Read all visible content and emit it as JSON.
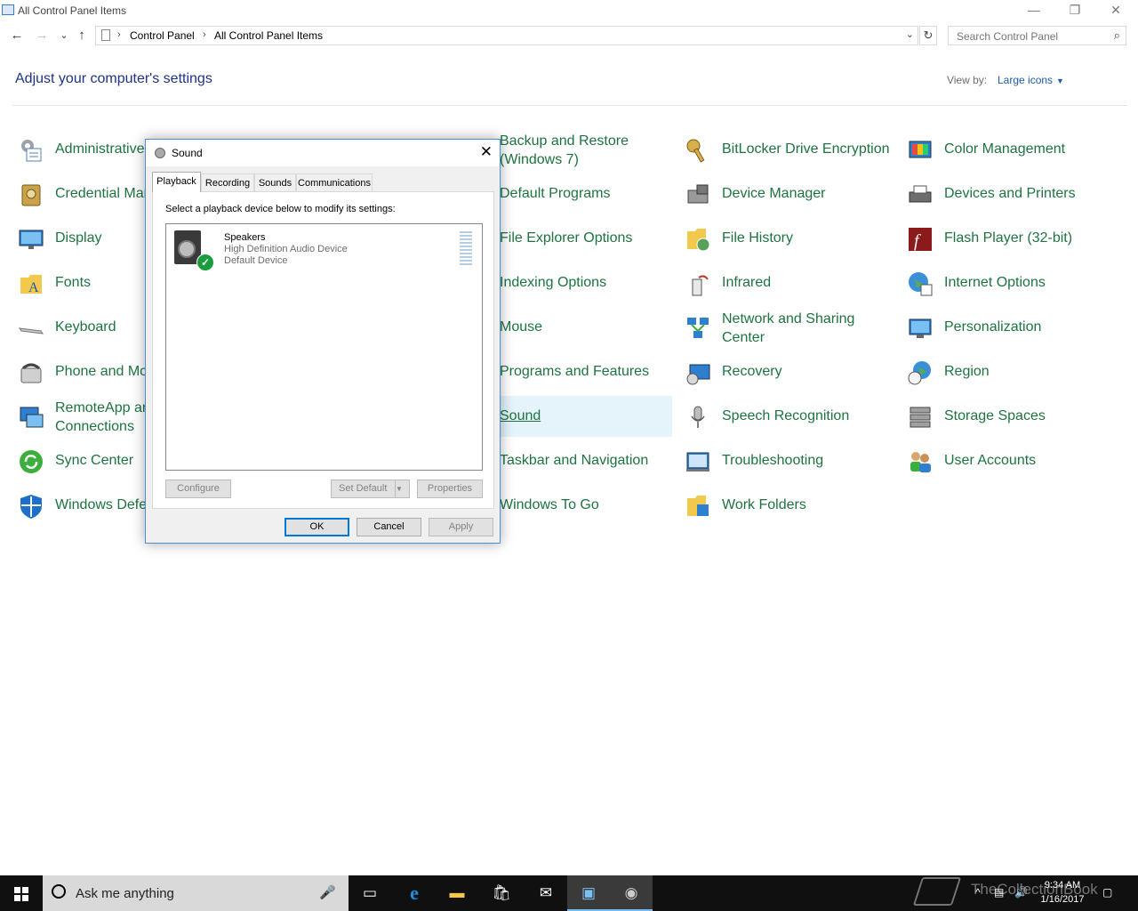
{
  "window": {
    "title": "All Control Panel Items",
    "minimize": "—",
    "restore": "❐",
    "close": "✕"
  },
  "nav": {
    "back": "←",
    "forward": "→",
    "recent": "⌄",
    "up": "↑",
    "breadcrumb": [
      "Control Panel",
      "All Control Panel Items"
    ],
    "refresh": "↻",
    "search_placeholder": "Search Control Panel"
  },
  "header": {
    "title": "Adjust your computer's settings",
    "view_by_label": "View by:",
    "view_by_value": "Large icons"
  },
  "items": {
    "col1": [
      "Administrative Tools",
      "Credential Manager",
      "Display",
      "Fonts",
      "Keyboard",
      "Phone and Modem",
      "RemoteApp and Desktop Connections",
      "Sync Center",
      "Windows Defender Firewall"
    ],
    "col1_visible": [
      "Administrative",
      "Credential Man",
      "Display",
      "Fonts",
      "Keyboard",
      "Phone and Mo",
      "RemoteApp an Connections",
      "Sync Center",
      "Windows Defe"
    ],
    "col3": [
      "Backup and Restore (Windows 7)",
      "Default Programs",
      "File Explorer Options",
      "Indexing Options",
      "Mouse",
      "Programs and Features",
      "Sound",
      "Taskbar and Navigation",
      "Windows To Go"
    ],
    "col4": [
      "BitLocker Drive Encryption",
      "Device Manager",
      "File History",
      "Infrared",
      "Network and Sharing Center",
      "Recovery",
      "Speech Recognition",
      "Troubleshooting",
      "Work Folders"
    ],
    "col5": [
      "Color Management",
      "Devices and Printers",
      "Flash Player (32-bit)",
      "Internet Options",
      "Personalization",
      "Region",
      "Storage Spaces",
      "User Accounts"
    ]
  },
  "dialog": {
    "title": "Sound",
    "close": "✕",
    "tabs": [
      "Playback",
      "Recording",
      "Sounds",
      "Communications"
    ],
    "active_tab": "Playback",
    "instruction": "Select a playback device below to modify its settings:",
    "device": {
      "name": "Speakers",
      "driver": "High Definition Audio Device",
      "status": "Default Device"
    },
    "buttons": {
      "configure": "Configure",
      "set_default": "Set Default",
      "properties": "Properties",
      "ok": "OK",
      "cancel": "Cancel",
      "apply": "Apply"
    }
  },
  "taskbar": {
    "search_text": "Ask me anything",
    "mic": "🎤",
    "time": "9:34 AM",
    "date": "1/16/2017",
    "watermark": "TheCollectionBook"
  },
  "colors": {
    "link_green": "#1e7340",
    "heading_blue": "#1e3287",
    "highlight": "#e5f3fb",
    "taskbar": "#101010"
  }
}
